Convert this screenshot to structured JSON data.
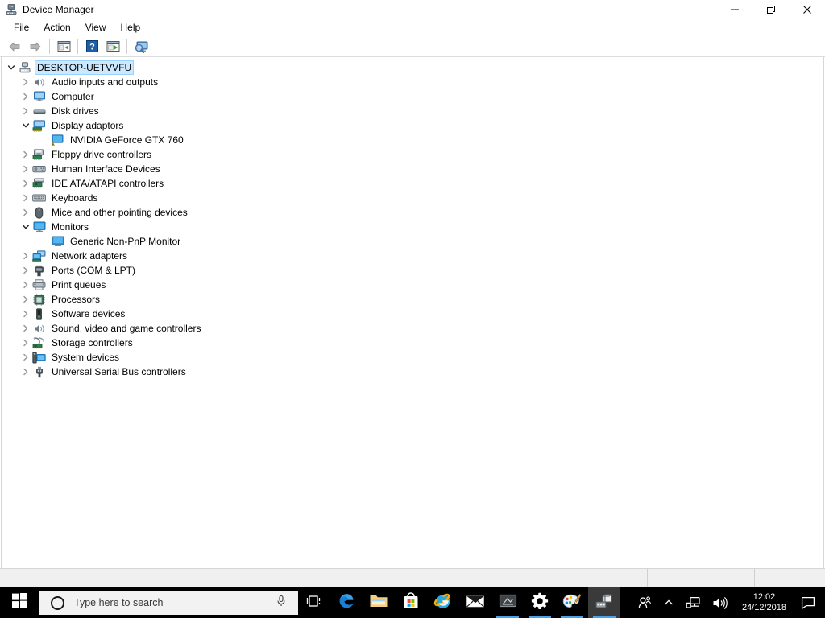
{
  "window": {
    "title": "Device Manager",
    "icon": "device-manager-icon",
    "controls": {
      "minimize": "—",
      "restore": "restore-icon",
      "close": "✕"
    }
  },
  "menubar": {
    "items": [
      {
        "label": "File",
        "name": "menu-file"
      },
      {
        "label": "Action",
        "name": "menu-action"
      },
      {
        "label": "View",
        "name": "menu-view"
      },
      {
        "label": "Help",
        "name": "menu-help"
      }
    ]
  },
  "toolbar": {
    "buttons": [
      {
        "name": "back-button",
        "icon": "back-arrow-icon",
        "title": "Back"
      },
      {
        "name": "forward-button",
        "icon": "forward-arrow-icon",
        "title": "Forward"
      },
      {
        "name": "show-hide-console-tree-button",
        "icon": "console-tree-icon",
        "title": "Show/Hide Console Tree"
      },
      {
        "name": "help-button",
        "icon": "help-question-icon",
        "title": "Help"
      },
      {
        "name": "properties-button",
        "icon": "properties-icon",
        "title": "Properties"
      },
      {
        "name": "scan-hardware-changes-button",
        "icon": "scan-hardware-icon",
        "title": "Scan for hardware changes"
      }
    ]
  },
  "tree": {
    "nodes": [
      {
        "label": "DESKTOP-UETVVFU",
        "depth": 0,
        "state": "expanded",
        "icon": "computer-root-icon",
        "selected": true
      },
      {
        "label": "Audio inputs and outputs",
        "depth": 1,
        "state": "collapsed",
        "icon": "speaker-icon",
        "selected": false
      },
      {
        "label": "Computer",
        "depth": 1,
        "state": "collapsed",
        "icon": "monitor-icon",
        "selected": false
      },
      {
        "label": "Disk drives",
        "depth": 1,
        "state": "collapsed",
        "icon": "disk-drive-icon",
        "selected": false
      },
      {
        "label": "Display adaptors",
        "depth": 1,
        "state": "expanded",
        "icon": "display-adapter-icon",
        "selected": false
      },
      {
        "label": "NVIDIA GeForce GTX 760",
        "depth": 2,
        "state": "leaf",
        "icon": "display-adapter-warning-icon",
        "selected": false
      },
      {
        "label": "Floppy drive controllers",
        "depth": 1,
        "state": "collapsed",
        "icon": "floppy-controller-icon",
        "selected": false
      },
      {
        "label": "Human Interface Devices",
        "depth": 1,
        "state": "collapsed",
        "icon": "hid-icon",
        "selected": false
      },
      {
        "label": "IDE ATA/ATAPI controllers",
        "depth": 1,
        "state": "collapsed",
        "icon": "ide-controller-icon",
        "selected": false
      },
      {
        "label": "Keyboards",
        "depth": 1,
        "state": "collapsed",
        "icon": "keyboard-icon",
        "selected": false
      },
      {
        "label": "Mice and other pointing devices",
        "depth": 1,
        "state": "collapsed",
        "icon": "mouse-icon",
        "selected": false
      },
      {
        "label": "Monitors",
        "depth": 1,
        "state": "expanded",
        "icon": "monitor-blue-icon",
        "selected": false
      },
      {
        "label": "Generic Non-PnP Monitor",
        "depth": 2,
        "state": "leaf",
        "icon": "monitor-blue-icon",
        "selected": false
      },
      {
        "label": "Network adapters",
        "depth": 1,
        "state": "collapsed",
        "icon": "network-adapter-icon",
        "selected": false
      },
      {
        "label": "Ports (COM & LPT)",
        "depth": 1,
        "state": "collapsed",
        "icon": "port-icon",
        "selected": false
      },
      {
        "label": "Print queues",
        "depth": 1,
        "state": "collapsed",
        "icon": "printer-icon",
        "selected": false
      },
      {
        "label": "Processors",
        "depth": 1,
        "state": "collapsed",
        "icon": "processor-icon",
        "selected": false
      },
      {
        "label": "Software devices",
        "depth": 1,
        "state": "collapsed",
        "icon": "software-device-icon",
        "selected": false
      },
      {
        "label": "Sound, video and game controllers",
        "depth": 1,
        "state": "collapsed",
        "icon": "speaker-icon",
        "selected": false
      },
      {
        "label": "Storage controllers",
        "depth": 1,
        "state": "collapsed",
        "icon": "storage-controller-icon",
        "selected": false
      },
      {
        "label": "System devices",
        "depth": 1,
        "state": "collapsed",
        "icon": "system-device-icon",
        "selected": false
      },
      {
        "label": "Universal Serial Bus controllers",
        "depth": 1,
        "state": "collapsed",
        "icon": "usb-icon",
        "selected": false
      }
    ]
  },
  "statusbar": {
    "main_text": "",
    "segment1_text": "",
    "segment2_text": ""
  },
  "taskbar": {
    "start": {
      "name": "start-button",
      "icon": "windows-logo-icon"
    },
    "search": {
      "placeholder": "Type here to search",
      "value": "",
      "cortana_icon": "cortana-circle-icon",
      "mic_icon": "microphone-icon"
    },
    "apps": [
      {
        "name": "task-view-button",
        "icon": "task-view-icon",
        "running": false,
        "active": false
      },
      {
        "name": "taskbar-edge",
        "icon": "edge-icon",
        "running": false,
        "active": false
      },
      {
        "name": "taskbar-file-explorer",
        "icon": "file-explorer-icon",
        "running": false,
        "active": false
      },
      {
        "name": "taskbar-microsoft-store",
        "icon": "microsoft-store-icon",
        "running": false,
        "active": false
      },
      {
        "name": "taskbar-internet-explorer",
        "icon": "internet-explorer-icon",
        "running": false,
        "active": false
      },
      {
        "name": "taskbar-mail",
        "icon": "mail-icon",
        "running": false,
        "active": false
      },
      {
        "name": "taskbar-screen-app",
        "icon": "screen-app-icon",
        "running": true,
        "active": false
      },
      {
        "name": "taskbar-settings",
        "icon": "settings-gear-icon",
        "running": true,
        "active": false
      },
      {
        "name": "taskbar-paint",
        "icon": "paint-palette-icon",
        "running": true,
        "active": false
      },
      {
        "name": "taskbar-device-manager",
        "icon": "device-manager-icon",
        "running": true,
        "active": true
      }
    ],
    "tray": {
      "people": {
        "name": "tray-people",
        "icon": "people-icon"
      },
      "show_hidden": {
        "name": "tray-show-hidden-icons",
        "icon": "chevron-up-icon"
      },
      "network": {
        "name": "tray-network",
        "icon": "ethernet-icon"
      },
      "volume": {
        "name": "tray-volume",
        "icon": "speaker-icon"
      },
      "clock": {
        "time": "12:02",
        "date": "24/12/2018"
      },
      "action_center": {
        "name": "action-center-button",
        "icon": "notification-bubble-icon"
      }
    }
  },
  "colors": {
    "accent": "#4ba0e8",
    "selection": "#cce8ff",
    "taskbar_bg": "#000000",
    "warning": "#ffd800",
    "window_bg": "#ffffff"
  }
}
